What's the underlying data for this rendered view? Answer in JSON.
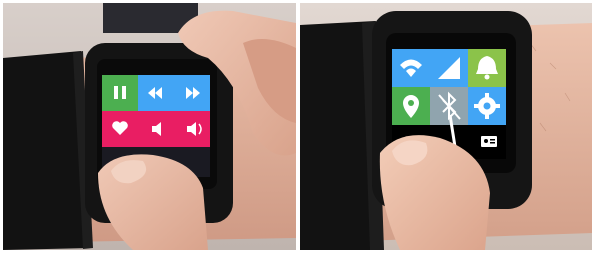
{
  "image": {
    "kind": "photo-pair",
    "panels": [
      {
        "id": "left",
        "subject": "smartwatch-music-controls",
        "tiles": [
          {
            "icon": "pause-icon",
            "color": "#4caf50"
          },
          {
            "icon": "previous-track-icon",
            "color": "#42a5f5"
          },
          {
            "icon": "next-track-icon",
            "color": "#42a5f5"
          },
          {
            "icon": "heart-icon",
            "color": "#e91e63"
          },
          {
            "icon": "volume-down-icon",
            "color": "#e91e63"
          },
          {
            "icon": "volume-up-icon",
            "color": "#e91e63"
          }
        ]
      },
      {
        "id": "right",
        "subject": "smartwatch-quick-settings",
        "tiles": [
          {
            "icon": "wifi-icon",
            "color": "#42a5f5"
          },
          {
            "icon": "cellular-signal-icon",
            "color": "#42a5f5"
          },
          {
            "icon": "alarm-bell-icon",
            "color": "#8bc34a"
          },
          {
            "icon": "location-pin-icon",
            "color": "#4caf50"
          },
          {
            "icon": "bluetooth-off-icon",
            "color": "#90a4ae"
          },
          {
            "icon": "settings-gear-icon",
            "color": "#42a5f5"
          },
          {
            "icon": "contact-card-icon",
            "color": "#000000"
          }
        ]
      }
    ],
    "colors": {
      "background": "#ffffff",
      "watch_body": "#161616",
      "strap": "#111111",
      "skin": "#e7b8a1",
      "wall": "#cfc5c0"
    }
  }
}
